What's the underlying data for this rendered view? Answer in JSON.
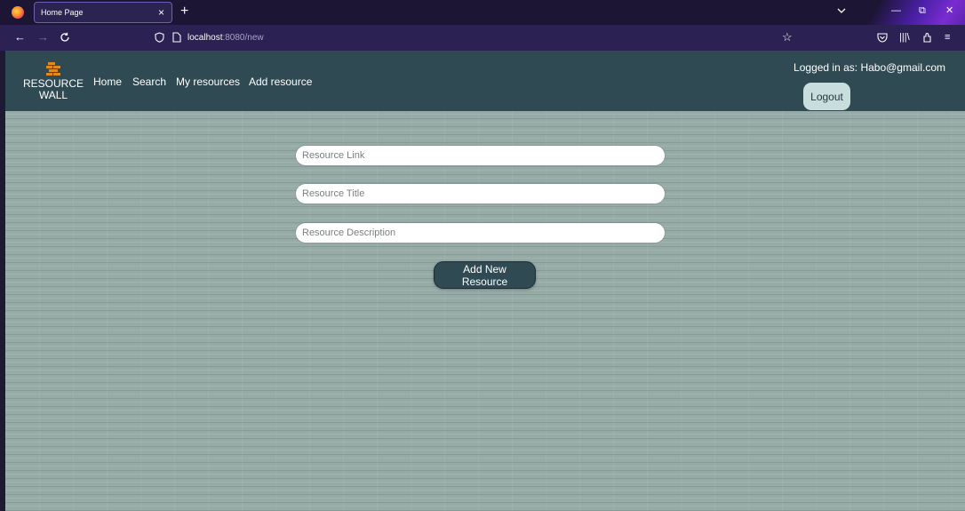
{
  "browser": {
    "tab_title": "Home Page",
    "url_host": "localhost",
    "url_path": ":8080/new",
    "new_tab": "+",
    "tab_close": "×",
    "icons": {
      "back": "back-arrow-icon",
      "forward": "forward-arrow-icon",
      "reload": "reload-icon",
      "star": "bookmark-star-icon",
      "pocket": "pocket-icon",
      "library": "library-icon",
      "extensions": "extensions-icon",
      "menu": "hamburger-menu-icon"
    }
  },
  "header": {
    "logo_line1": "RESOURCE",
    "logo_line2": "WALL",
    "nav": [
      "Home",
      "Search",
      "My resources",
      "Add resource"
    ],
    "logged_in": "Logged in as: Habo@gmail.com",
    "logout": "Logout"
  },
  "form": {
    "link_placeholder": "Resource Link",
    "title_placeholder": "Resource Title",
    "description_placeholder": "Resource Description",
    "submit_label": "Add New Resource"
  },
  "colors": {
    "navbar": "#2f4a52",
    "page_bg": "#96aaa6",
    "logout_bg": "#c8dedc",
    "logo_accent": "#e08a1e"
  }
}
